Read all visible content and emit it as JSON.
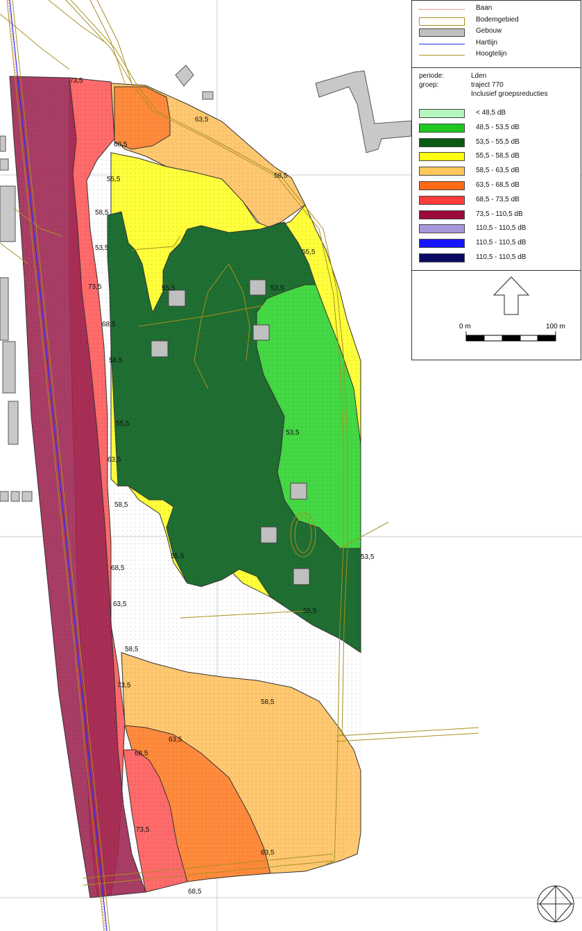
{
  "legend": {
    "items": [
      {
        "label": "Baan"
      },
      {
        "label": "Bodemgebied"
      },
      {
        "label": "Gebouw"
      },
      {
        "label": "Hartlijn"
      },
      {
        "label": "Hoogtelijn"
      }
    ],
    "info": {
      "periode_key": "periode:",
      "periode_val": "Lden",
      "groep_key": "groep:",
      "groep_val1": "traject 770",
      "groep_val2": "Inclusief groepsreducties"
    },
    "classes": [
      {
        "label": "< 48,5 dB",
        "color": "#b6f5c0"
      },
      {
        "label": "48,5 - 53,5 dB",
        "color": "#1ec81e"
      },
      {
        "label": "53,5 - 55,5 dB",
        "color": "#0a5a14"
      },
      {
        "label": "55,5 - 58,5 dB",
        "color": "#ffff14"
      },
      {
        "label": "58,5 - 63,5 dB",
        "color": "#ffc85a"
      },
      {
        "label": "63,5 - 68,5 dB",
        "color": "#ff6a14"
      },
      {
        "label": "68,5 - 73,5 dB",
        "color": "#ff3c3c"
      },
      {
        "label": "73,5 - 110,5 dB",
        "color": "#9a0a3a"
      },
      {
        "label": "110,5 - 110,5 dB",
        "color": "#a896dc"
      },
      {
        "label": "110,5 - 110,5 dB",
        "color": "#1414ff"
      },
      {
        "label": "110,5 - 110,5 dB",
        "color": "#0a0a64"
      }
    ],
    "scale": {
      "start": "0 m",
      "end": "100 m"
    }
  },
  "contour_labels": [
    "73,5",
    "63,5",
    "68,5",
    "58,5",
    "55,5",
    "58,5",
    "53,5",
    "73,5",
    "55,5",
    "53,5",
    "55,5",
    "68,5",
    "58,5",
    "55,5",
    "53,5",
    "63,5",
    "58,5",
    "55,5",
    "53,5",
    "68,5",
    "63,5",
    "55,5",
    "58,5",
    "73,5",
    "58,5",
    "63,5",
    "68,5",
    "73,5",
    "63,5",
    "68,5"
  ]
}
